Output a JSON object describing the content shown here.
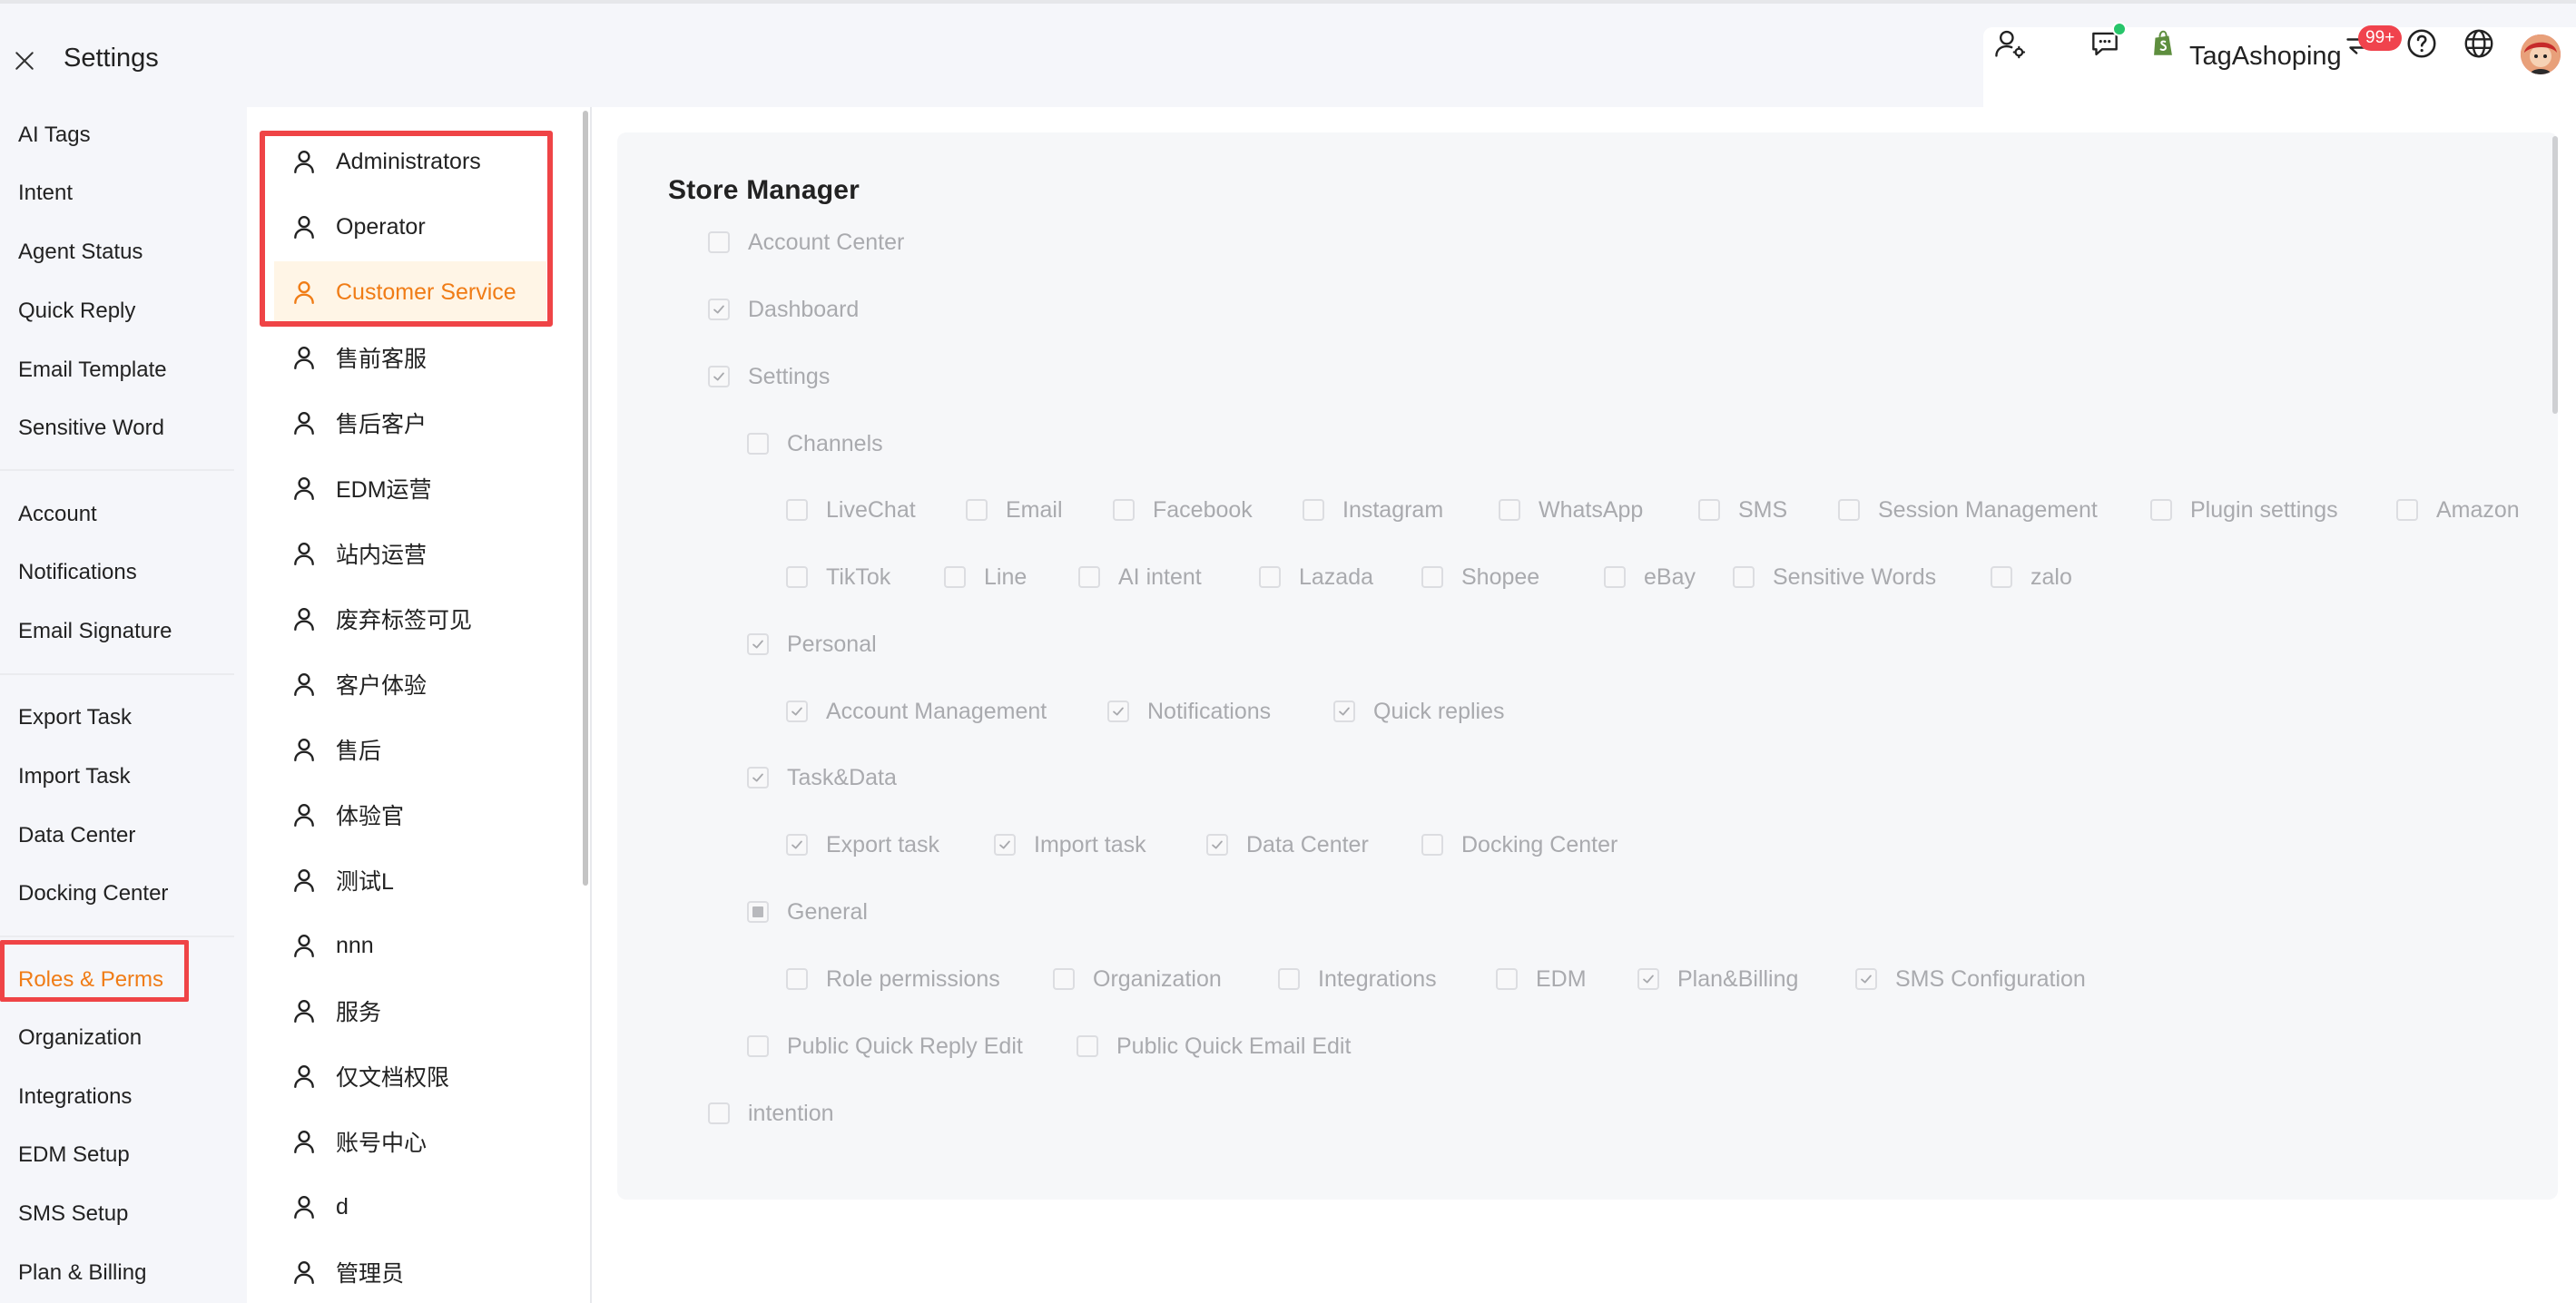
{
  "header": {
    "title": "Settings",
    "store_name": "TagAshoping",
    "notification_badge": "99+"
  },
  "nav": {
    "items": [
      {
        "label": "AI Tags",
        "active": false
      },
      {
        "label": "Intent",
        "active": false
      },
      {
        "label": "Agent Status",
        "active": false
      },
      {
        "label": "Quick Reply",
        "active": false
      },
      {
        "label": "Email Template",
        "active": false
      },
      {
        "label": "Sensitive Word",
        "active": false
      },
      {
        "label": "Account",
        "active": false
      },
      {
        "label": "Notifications",
        "active": false
      },
      {
        "label": "Email Signature",
        "active": false
      },
      {
        "label": "Export Task",
        "active": false
      },
      {
        "label": "Import Task",
        "active": false
      },
      {
        "label": "Data Center",
        "active": false
      },
      {
        "label": "Docking Center",
        "active": false
      },
      {
        "label": "Roles & Perms",
        "active": true
      },
      {
        "label": "Organization",
        "active": false
      },
      {
        "label": "Integrations",
        "active": false
      },
      {
        "label": "EDM Setup",
        "active": false
      },
      {
        "label": "SMS Setup",
        "active": false
      },
      {
        "label": "Plan & Billing",
        "active": false
      }
    ]
  },
  "roles": {
    "items": [
      {
        "label": "Administrators",
        "active": false
      },
      {
        "label": "Operator",
        "active": false
      },
      {
        "label": "Customer Service",
        "active": true
      },
      {
        "label": "售前客服",
        "active": false
      },
      {
        "label": "售后客户",
        "active": false
      },
      {
        "label": "EDM运营",
        "active": false
      },
      {
        "label": "站内运营",
        "active": false
      },
      {
        "label": "废弃标签可见",
        "active": false
      },
      {
        "label": "客户体验",
        "active": false
      },
      {
        "label": "售后",
        "active": false
      },
      {
        "label": "体验官",
        "active": false
      },
      {
        "label": "测试L",
        "active": false
      },
      {
        "label": "nnn",
        "active": false
      },
      {
        "label": "服务",
        "active": false
      },
      {
        "label": "仅文档权限",
        "active": false
      },
      {
        "label": "账号中心",
        "active": false
      },
      {
        "label": "d",
        "active": false
      },
      {
        "label": "管理员",
        "active": false
      }
    ]
  },
  "permissions": {
    "title": "Store Manager",
    "items": [
      {
        "label": "Account Center",
        "state": "unchecked"
      },
      {
        "label": "Dashboard",
        "state": "checked"
      },
      {
        "label": "Settings",
        "state": "checked"
      },
      {
        "label": "Channels",
        "state": "unchecked"
      },
      {
        "label": "LiveChat",
        "state": "unchecked"
      },
      {
        "label": "Email",
        "state": "unchecked"
      },
      {
        "label": "Facebook",
        "state": "unchecked"
      },
      {
        "label": "Instagram",
        "state": "unchecked"
      },
      {
        "label": "WhatsApp",
        "state": "unchecked"
      },
      {
        "label": "SMS",
        "state": "unchecked"
      },
      {
        "label": "Session Management",
        "state": "unchecked"
      },
      {
        "label": "Plugin settings",
        "state": "unchecked"
      },
      {
        "label": "Amazon",
        "state": "unchecked"
      },
      {
        "label": "TikTok",
        "state": "unchecked"
      },
      {
        "label": "Line",
        "state": "unchecked"
      },
      {
        "label": "AI intent",
        "state": "unchecked"
      },
      {
        "label": "Lazada",
        "state": "unchecked"
      },
      {
        "label": "Shopee",
        "state": "unchecked"
      },
      {
        "label": "eBay",
        "state": "unchecked"
      },
      {
        "label": "Sensitive Words",
        "state": "unchecked"
      },
      {
        "label": "zalo",
        "state": "unchecked"
      },
      {
        "label": "Personal",
        "state": "checked"
      },
      {
        "label": "Account Management",
        "state": "checked"
      },
      {
        "label": "Notifications",
        "state": "checked"
      },
      {
        "label": "Quick replies",
        "state": "checked"
      },
      {
        "label": "Task&Data",
        "state": "checked"
      },
      {
        "label": "Export task",
        "state": "checked"
      },
      {
        "label": "Import task",
        "state": "checked"
      },
      {
        "label": "Data Center",
        "state": "checked"
      },
      {
        "label": "Docking Center",
        "state": "unchecked"
      },
      {
        "label": "General",
        "state": "indeterminate"
      },
      {
        "label": "Role permissions",
        "state": "unchecked"
      },
      {
        "label": "Organization",
        "state": "unchecked"
      },
      {
        "label": "Integrations",
        "state": "unchecked"
      },
      {
        "label": "EDM",
        "state": "unchecked"
      },
      {
        "label": "Plan&Billing",
        "state": "checked"
      },
      {
        "label": "SMS Configuration",
        "state": "checked"
      },
      {
        "label": "Public Quick Reply Edit",
        "state": "unchecked"
      },
      {
        "label": "Public Quick Email Edit",
        "state": "unchecked"
      },
      {
        "label": "intention",
        "state": "unchecked"
      }
    ]
  },
  "icons": {
    "close": "close-icon",
    "user_settings": "user-settings-icon",
    "chat": "chat-icon",
    "shopify": "shopify-icon",
    "switch": "switch-icon",
    "help": "help-icon",
    "globe": "globe-icon",
    "role": "user-icon"
  },
  "colors": {
    "accent": "#f07c16",
    "highlight_border": "#ef4446",
    "badge": "#f0434d",
    "online_dot": "#27c56a",
    "shopify_green": "#5e8e3e"
  }
}
